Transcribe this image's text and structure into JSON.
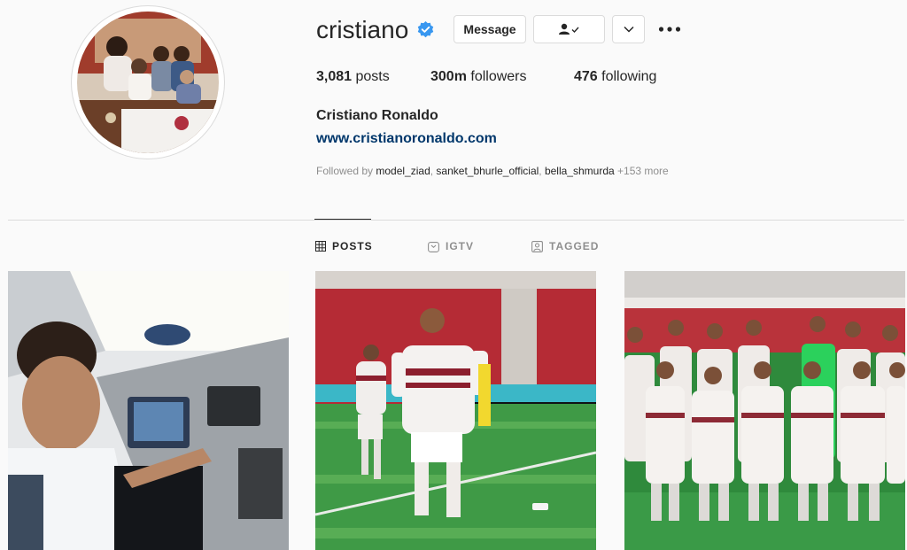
{
  "profile": {
    "username": "cristiano",
    "full_name": "Cristiano Ronaldo",
    "website": "www.cristianoronaldo.com",
    "verified": true
  },
  "actions": {
    "message_label": "Message",
    "following_icon": "person-check-icon",
    "chevron_icon": "chevron-down-icon",
    "more_icon": "more-dots-icon"
  },
  "stats": {
    "posts_count": "3,081",
    "posts_label": "posts",
    "followers_count": "300m",
    "followers_label": "followers",
    "following_count": "476",
    "following_label": "following"
  },
  "followed_by": {
    "prefix": "Followed by",
    "accounts": [
      "model_ziad",
      "sanket_bhurle_official",
      "bella_shmurda"
    ],
    "more": "+153 more"
  },
  "tabs": [
    {
      "label": "POSTS",
      "icon": "grid-icon",
      "active": true
    },
    {
      "label": "IGTV",
      "icon": "igtv-icon",
      "active": false
    },
    {
      "label": "TAGGED",
      "icon": "tagged-icon",
      "active": false
    }
  ],
  "posts": [
    {
      "subject": "boy in airplane cockpit"
    },
    {
      "subject": "football player celebrating in stadium"
    },
    {
      "subject": "team photo on pitch"
    }
  ],
  "colors": {
    "accent_link": "#00376b",
    "verified_blue": "#3897f0",
    "muted_text": "#8e8e8e",
    "border": "#dbdbdb"
  }
}
